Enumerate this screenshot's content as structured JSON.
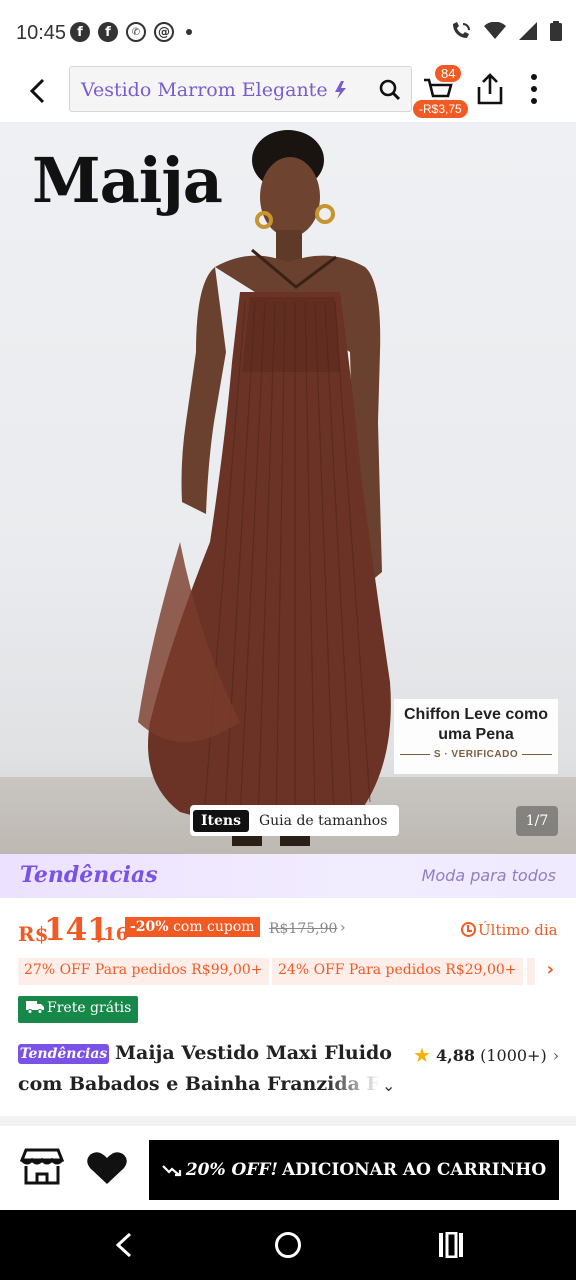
{
  "status_bar": {
    "time": "10:45",
    "left_icons": [
      "facebook-icon",
      "facebook-icon",
      "whatsapp-icon",
      "threads-icon",
      "dot-icon"
    ],
    "right_icons": [
      "wifi-call-icon",
      "wifi-icon",
      "signal-icon",
      "battery-icon"
    ]
  },
  "header": {
    "search_query": "Vestido Marrom Elegante",
    "cart_count": "84",
    "cart_discount": "-R$3,75"
  },
  "hero": {
    "brand_logo": "Maija",
    "feature_title": "Chiffon Leve como uma Pena",
    "feature_verified": "S · VERIFICADO",
    "tab_items": "Itens",
    "tab_size_guide": "Guia de tamanhos",
    "image_counter": "1/7"
  },
  "trend_banner": {
    "logo": "Tendências",
    "tagline": "Moda para todos"
  },
  "price": {
    "currency": "R$",
    "integer": "141",
    "decimal": ",16",
    "coupon_pct": "-20%",
    "coupon_text": "com cupom",
    "old_price": "R$175,90",
    "deadline": "Último dia"
  },
  "promos": [
    "27% OFF Para pedidos R$99,00+",
    "24% OFF Para pedidos R$29,00+"
  ],
  "shipping": "Frete grátis",
  "product": {
    "trend_chip": "Tendências",
    "title_line1": "Maija Vestido Maxi Fluido",
    "title_line2": "com Babados e Bainha Franzida Flor",
    "rating": "4,88",
    "reviews": "(1000+)"
  },
  "action_bar": {
    "discount_label": "20% OFF!",
    "add_to_cart": "ADICIONAR AO CARRINHO"
  },
  "colors": {
    "accent": "#f25a24",
    "trend_purple": "#7b52e8",
    "ship_green": "#17884a",
    "dress_brown": "#6b3326"
  }
}
